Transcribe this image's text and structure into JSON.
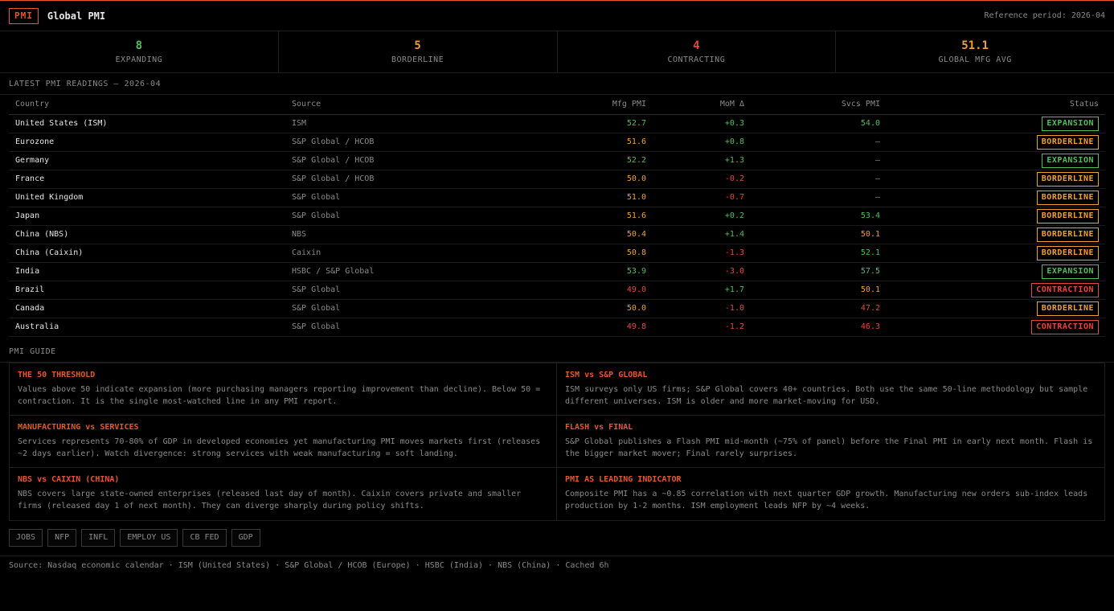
{
  "header": {
    "badge": "PMI",
    "title": "Global PMI",
    "reference": "Reference period: 2026-04"
  },
  "stats": [
    {
      "value": "8",
      "label": "EXPANDING",
      "color": "#4fbf5a"
    },
    {
      "value": "5",
      "label": "BORDERLINE",
      "color": "#f0a030"
    },
    {
      "value": "4",
      "label": "CONTRACTING",
      "color": "#e8463a"
    },
    {
      "value": "51.1",
      "label": "GLOBAL MFG AVG",
      "color": "#f0a030"
    }
  ],
  "readings_title": "LATEST PMI READINGS — 2026-04",
  "table": {
    "headers": [
      "Country",
      "Source",
      "Mfg PMI",
      "MoM Δ",
      "Svcs PMI",
      "Status"
    ],
    "rows": [
      {
        "country": "United States (ISM)",
        "source": "ISM",
        "mfg": "52.7",
        "mfg_c": "green",
        "mom": "+0.3",
        "mom_c": "green",
        "svcs": "54.0",
        "svcs_c": "green",
        "status": "EXPANSION",
        "st": "exp"
      },
      {
        "country": "Eurozone",
        "source": "S&P Global / HCOB",
        "mfg": "51.6",
        "mfg_c": "orange",
        "mom": "+0.8",
        "mom_c": "green",
        "svcs": "—",
        "svcs_c": "muted",
        "status": "BORDERLINE",
        "st": "bor"
      },
      {
        "country": "Germany",
        "source": "S&P Global / HCOB",
        "mfg": "52.2",
        "mfg_c": "green",
        "mom": "+1.3",
        "mom_c": "green",
        "svcs": "—",
        "svcs_c": "muted",
        "status": "EXPANSION",
        "st": "exp"
      },
      {
        "country": "France",
        "source": "S&P Global / HCOB",
        "mfg": "50.0",
        "mfg_c": "orange",
        "mom": "-0.2",
        "mom_c": "red",
        "svcs": "—",
        "svcs_c": "muted",
        "status": "BORDERLINE",
        "st": "bor"
      },
      {
        "country": "United Kingdom",
        "source": "S&P Global",
        "mfg": "51.0",
        "mfg_c": "orange",
        "mom": "-0.7",
        "mom_c": "red",
        "svcs": "—",
        "svcs_c": "muted",
        "status": "BORDERLINE",
        "st": "bor"
      },
      {
        "country": "Japan",
        "source": "S&P Global",
        "mfg": "51.6",
        "mfg_c": "orange",
        "mom": "+0.2",
        "mom_c": "green",
        "svcs": "53.4",
        "svcs_c": "green",
        "status": "BORDERLINE",
        "st": "bor"
      },
      {
        "country": "China (NBS)",
        "source": "NBS",
        "mfg": "50.4",
        "mfg_c": "orange",
        "mom": "+1.4",
        "mom_c": "green",
        "svcs": "50.1",
        "svcs_c": "orange",
        "status": "BORDERLINE",
        "st": "bor"
      },
      {
        "country": "China (Caixin)",
        "source": "Caixin",
        "mfg": "50.8",
        "mfg_c": "orange",
        "mom": "-1.3",
        "mom_c": "red",
        "svcs": "52.1",
        "svcs_c": "green",
        "status": "BORDERLINE",
        "st": "bor"
      },
      {
        "country": "India",
        "source": "HSBC / S&P Global",
        "mfg": "53.9",
        "mfg_c": "green",
        "mom": "-3.0",
        "mom_c": "red",
        "svcs": "57.5",
        "svcs_c": "green",
        "status": "EXPANSION",
        "st": "exp"
      },
      {
        "country": "Brazil",
        "source": "S&P Global",
        "mfg": "49.0",
        "mfg_c": "red",
        "mom": "+1.7",
        "mom_c": "green",
        "svcs": "50.1",
        "svcs_c": "orange",
        "status": "CONTRACTION",
        "st": "con"
      },
      {
        "country": "Canada",
        "source": "S&P Global",
        "mfg": "50.0",
        "mfg_c": "orange",
        "mom": "-1.0",
        "mom_c": "red",
        "svcs": "47.2",
        "svcs_c": "red",
        "status": "BORDERLINE",
        "st": "bor"
      },
      {
        "country": "Australia",
        "source": "S&P Global",
        "mfg": "49.8",
        "mfg_c": "red",
        "mom": "-1.2",
        "mom_c": "red",
        "svcs": "46.3",
        "svcs_c": "red",
        "status": "CONTRACTION",
        "st": "con"
      }
    ]
  },
  "guide_title": "PMI GUIDE",
  "guide": [
    {
      "title": "THE 50 THRESHOLD",
      "body": "Values above 50 indicate expansion (more purchasing managers reporting improvement than decline). Below 50 = contraction. It is the single most-watched line in any PMI report."
    },
    {
      "title": "ISM vs S&P GLOBAL",
      "body": "ISM surveys only US firms; S&P Global covers 40+ countries. Both use the same 50-line methodology but sample different universes. ISM is older and more market-moving for USD."
    },
    {
      "title": "MANUFACTURING vs SERVICES",
      "body": "Services represents 70-80% of GDP in developed economies yet manufacturing PMI moves markets first (releases ~2 days earlier). Watch divergence: strong services with weak manufacturing = soft landing."
    },
    {
      "title": "FLASH vs FINAL",
      "body": "S&P Global publishes a Flash PMI mid-month (~75% of panel) before the Final PMI in early next month. Flash is the bigger market mover; Final rarely surprises."
    },
    {
      "title": "NBS vs CAIXIN (CHINA)",
      "body": "NBS covers large state-owned enterprises (released last day of month). Caixin covers private and smaller firms (released day 1 of next month). They can diverge sharply during policy shifts."
    },
    {
      "title": "PMI AS LEADING INDICATOR",
      "body": "Composite PMI has a ~0.85 correlation with next quarter GDP growth. Manufacturing new orders sub-index leads production by 1-2 months. ISM employment leads NFP by ~4 weeks."
    }
  ],
  "tags": [
    "JOBS",
    "NFP",
    "INFL",
    "EMPLOY US",
    "CB FED",
    "GDP"
  ],
  "footer": "Source: Nasdaq economic calendar · ISM (United States) · S&P Global / HCOB (Europe) · HSBC (India) · NBS (China) · Cached 6h"
}
